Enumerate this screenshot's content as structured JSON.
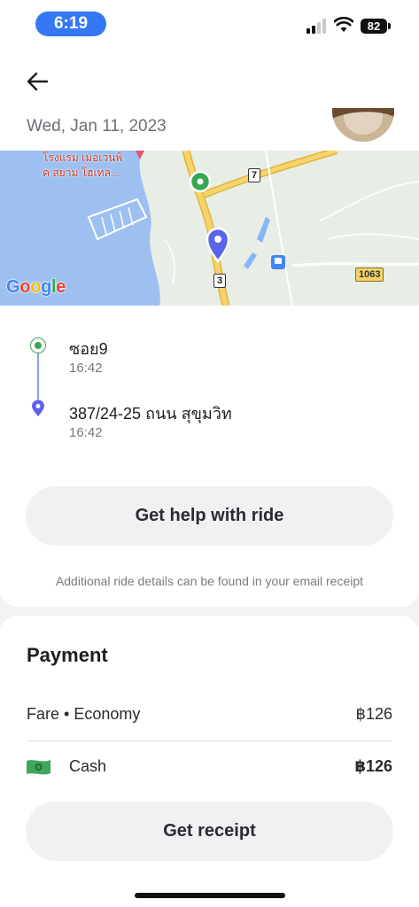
{
  "status_bar": {
    "time": "6:19",
    "battery": "82",
    "time_pill_color": "#3478f6"
  },
  "header": {
    "back_icon": "arrow-left-icon",
    "date": "Wed, Jan 11, 2023"
  },
  "map": {
    "poi_label": "โรงแรม เมอเวนพิ\nค สยาม โฮเทล...",
    "road_badge_1": "7",
    "road_badge_2": "3",
    "highway_badge": "1063",
    "google_logo": [
      "G",
      "o",
      "o",
      "g",
      "l",
      "e"
    ],
    "colors": {
      "sea": "#9ec0f0",
      "land": "#e8eee6",
      "road": "#f7c94b",
      "pickup": "#34a853",
      "dropoff": "#5b63e8"
    }
  },
  "route": {
    "stops": [
      {
        "name": "ซอย9",
        "time": "16:42",
        "type": "pickup"
      },
      {
        "name": "387/24-25 ถนน สุขุมวิท",
        "time": "16:42",
        "type": "dropoff"
      }
    ],
    "help_button": "Get help with ride",
    "note": "Additional ride details can be found in your email receipt"
  },
  "payment": {
    "title": "Payment",
    "fare_label": "Fare • Economy",
    "fare_amount": "฿126",
    "method_icon": "cash-icon",
    "method_label": "Cash",
    "method_amount": "฿126",
    "receipt_button": "Get receipt"
  }
}
